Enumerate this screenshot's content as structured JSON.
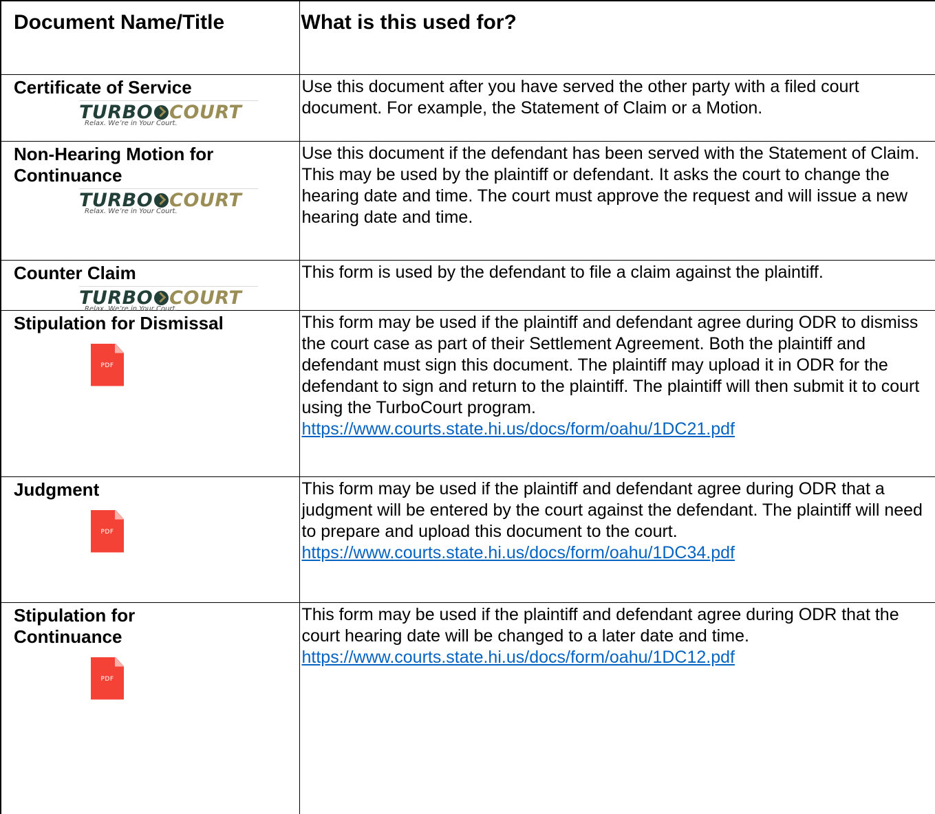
{
  "header": {
    "col1": "Document Name/Title",
    "col2": "What is this used for?"
  },
  "logo": {
    "brand_left": "TURBO",
    "brand_right": "COURT",
    "tagline": "Relax.  We’re in Your Court."
  },
  "pdf_icon": {
    "label": "PDF"
  },
  "rows": [
    {
      "name": "Certificate of Service",
      "description": "Use this document after you have served the other party with a filed court document. For example, the Statement of Claim or a Motion.",
      "link": ""
    },
    {
      "name": "Non-Hearing Motion for Continuance",
      "description": "Use this document if the defendant has been served with the Statement of Claim. This may be used by the plaintiff or defendant. It asks the court to change the hearing date and time. The court must approve the request and will issue a new hearing date and time.",
      "link": ""
    },
    {
      "name": "Counter Claim",
      "description": "This form is used by the defendant to file a claim against the plaintiff.",
      "link": ""
    },
    {
      "name": "Stipulation for Dismissal",
      "description": "This form may be used if the plaintiff and defendant agree during ODR to dismiss the court case as part of their Settlement Agreement. Both the plaintiff and defendant must sign this document. The plaintiff may upload it in ODR for the defendant to sign and return to the plaintiff. The plaintiff will then submit it to court using the TurboCourt program.",
      "link": "https://www.courts.state.hi.us/docs/form/oahu/1DC21.pdf"
    },
    {
      "name": "Judgment",
      "description": "This form may be used if the plaintiff and defendant agree during ODR that a judgment will be entered by the court against the defendant. The plaintiff will need to prepare and upload this document to the court.",
      "link": "https://www.courts.state.hi.us/docs/form/oahu/1DC34.pdf"
    },
    {
      "name": "Stipulation for Continuance",
      "description": "This form may be used if the plaintiff and defendant agree during ODR that the court hearing date will be changed to a later date and time.",
      "link": "https://www.courts.state.hi.us/docs/form/oahu/1DC12.pdf"
    }
  ]
}
